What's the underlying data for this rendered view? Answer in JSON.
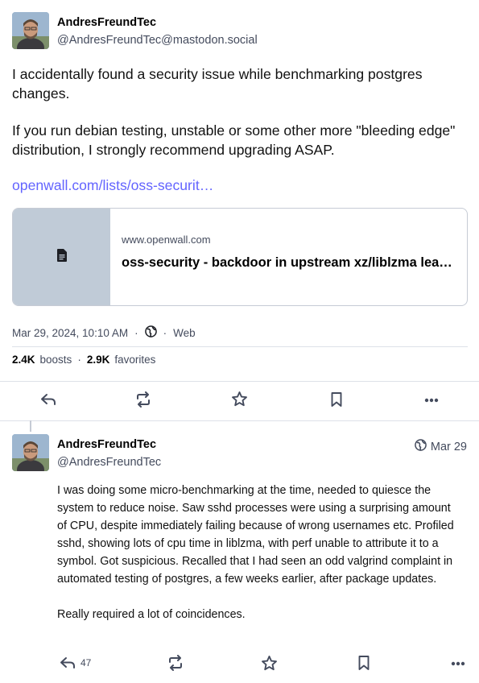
{
  "post": {
    "author_name": "AndresFreundTec",
    "author_handle": "@AndresFreundTec@mastodon.social",
    "paragraphs": [
      "I accidentally found a security issue while benchmarking postgres changes.",
      "If you run debian testing, unstable or some other more \"bleeding edge\" distribution, I strongly recommend upgrading ASAP."
    ],
    "link_text": "openwall.com/lists/oss-securit…",
    "card": {
      "domain": "www.openwall.com",
      "title": "oss-security - backdoor in upstream xz/liblzma leads to ssh server compromise",
      "thumb_icon": "file-icon"
    },
    "timestamp": "Mar 29, 2024, 10:10 AM",
    "visibility": "Web",
    "boosts_count": "2.4K",
    "boosts_label": "boosts",
    "favorites_count": "2.9K",
    "favorites_label": "favorites",
    "actions": [
      "reply-icon",
      "boost-icon",
      "favorite-icon",
      "bookmark-icon",
      "more-icon"
    ]
  },
  "reply": {
    "author_name": "AndresFreundTec",
    "author_handle": "@AndresFreundTec",
    "time": "Mar 29",
    "paragraphs": [
      "I was doing some micro-benchmarking at the time, needed to quiesce the system to reduce noise. Saw sshd processes were using a surprising amount of CPU, despite immediately failing because of wrong usernames etc. Profiled sshd, showing lots of cpu time in liblzma, with perf unable to attribute it to a symbol. Got suspicious. Recalled that I had seen an odd valgrind complaint in automated testing of postgres, a few weeks earlier, after  package updates.",
      "Really required a lot of coincidences."
    ],
    "reply_count": "47"
  },
  "colors": {
    "link": "#6364ff",
    "secondary_text": "#444b5d",
    "border": "#c6cbd5",
    "thumb_bg": "#c0cbd7"
  }
}
